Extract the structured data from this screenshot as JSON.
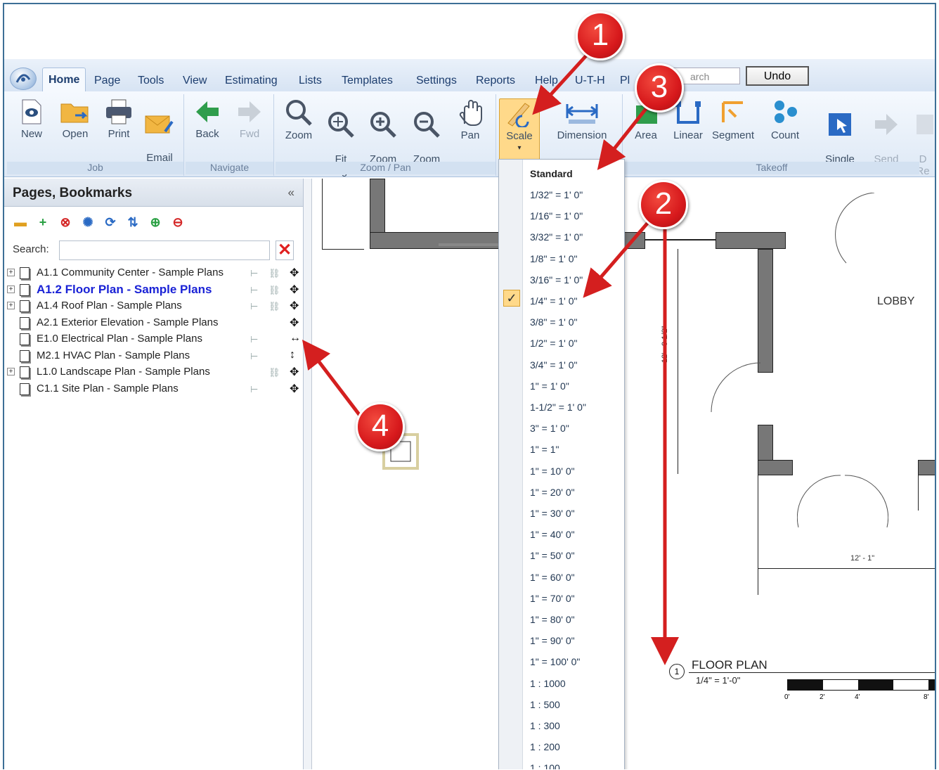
{
  "tabs": [
    "Home",
    "Page",
    "Tools",
    "View",
    "Estimating",
    "Lists",
    "Templates",
    "Settings",
    "Reports",
    "Help",
    "U-T-H",
    "Pl"
  ],
  "search_placeholder": "arch",
  "undo_label": "Undo",
  "ribbon": {
    "job": {
      "label": "Job",
      "buttons": [
        "New",
        "Open",
        "Print",
        "Email\nJob"
      ]
    },
    "navigate": {
      "label": "Navigate",
      "buttons": [
        "Back",
        "Fwd"
      ]
    },
    "zoom": {
      "label": "Zoom / Pan",
      "buttons": [
        "Zoom",
        "Fit\nPage",
        "Zoom\nIn",
        "Zoom\nOut",
        "Pan"
      ]
    },
    "scale": {
      "buttons": [
        "Scale",
        "Dimension"
      ]
    },
    "takeoff": {
      "label": "Takeoff",
      "buttons": [
        "Area",
        "Linear",
        "Segment",
        "Count",
        "Single\nClick",
        "Send\nData",
        "D\nRe"
      ]
    }
  },
  "panel": {
    "title": "Pages, Bookmarks",
    "collapse": "«",
    "search_label": "Search:",
    "pages": [
      {
        "name": "A1.1 Community Center - Sample Plans",
        "expand": "+",
        "i1": "⊢",
        "i2": "⛓",
        "i3": "✥",
        "current": false
      },
      {
        "name": "A1.2 Floor Plan - Sample Plans",
        "expand": "+",
        "i1": "⊢",
        "i2": "⛓",
        "i3": "✥",
        "current": true
      },
      {
        "name": "A1.4 Roof Plan - Sample Plans",
        "expand": "+",
        "i1": "⊢",
        "i2": "⛓",
        "i3": "✥",
        "current": false
      },
      {
        "name": "A2.1 Exterior Elevation - Sample Plans",
        "expand": "",
        "i1": "",
        "i2": "",
        "i3": "✥",
        "current": false
      },
      {
        "name": "E1.0 Electrical Plan - Sample Plans",
        "expand": "",
        "i1": "⊢",
        "i2": "",
        "i3": "↔",
        "current": false
      },
      {
        "name": "M2.1 HVAC Plan - Sample Plans",
        "expand": "",
        "i1": "⊢",
        "i2": "",
        "i3": "↕",
        "current": false
      },
      {
        "name": "L1.0 Landscape Plan - Sample Plans",
        "expand": "+",
        "i1": "",
        "i2": "⛓",
        "i3": "✥",
        "current": false
      },
      {
        "name": "C1.1 Site Plan - Sample Plans",
        "expand": "",
        "i1": "⊢",
        "i2": "",
        "i3": "✥",
        "current": false
      }
    ]
  },
  "scale_menu": {
    "header": "Standard",
    "selected": "1/4\" = 1' 0\"",
    "items": [
      "1/32\" = 1' 0\"",
      "1/16\" = 1' 0\"",
      "3/32\" = 1' 0\"",
      "1/8\" = 1' 0\"",
      "3/16\" = 1' 0\"",
      "1/4\" = 1' 0\"",
      "3/8\" = 1' 0\"",
      "1/2\" = 1' 0\"",
      "3/4\" = 1' 0\"",
      "1\" = 1' 0\"",
      "1-1/2\" = 1' 0\"",
      "3\" = 1' 0\"",
      "1\" = 1\"",
      "1\" = 10' 0\"",
      "1\" = 20' 0\"",
      "1\" = 30' 0\"",
      "1\" = 40' 0\"",
      "1\" = 50' 0\"",
      "1\" = 60' 0\"",
      "1\" = 70' 0\"",
      "1\" = 80' 0\"",
      "1\" = 90' 0\"",
      "1\" = 100' 0\"",
      "1 : 1000",
      "1 : 500",
      "1 : 300",
      "1 : 200",
      "1 : 100"
    ]
  },
  "drawing": {
    "room": "LOBBY",
    "dim_vertical": "12' - 9 1/2\"",
    "dim_horizontal": "12' - 1\"",
    "title_num": "1",
    "title": "FLOOR PLAN",
    "scale_text": "1/4\" = 1'-0\"",
    "scale_ticks": [
      "0'",
      "2'",
      "4'",
      "8'"
    ]
  },
  "callouts": [
    "1",
    "2",
    "3",
    "4"
  ],
  "colors": {
    "callout": "#d7191c",
    "arrow": "#d41f1f",
    "ribbon": "#dde8f5",
    "selected": "#ffd98a",
    "current_page": "#1a22d6"
  }
}
